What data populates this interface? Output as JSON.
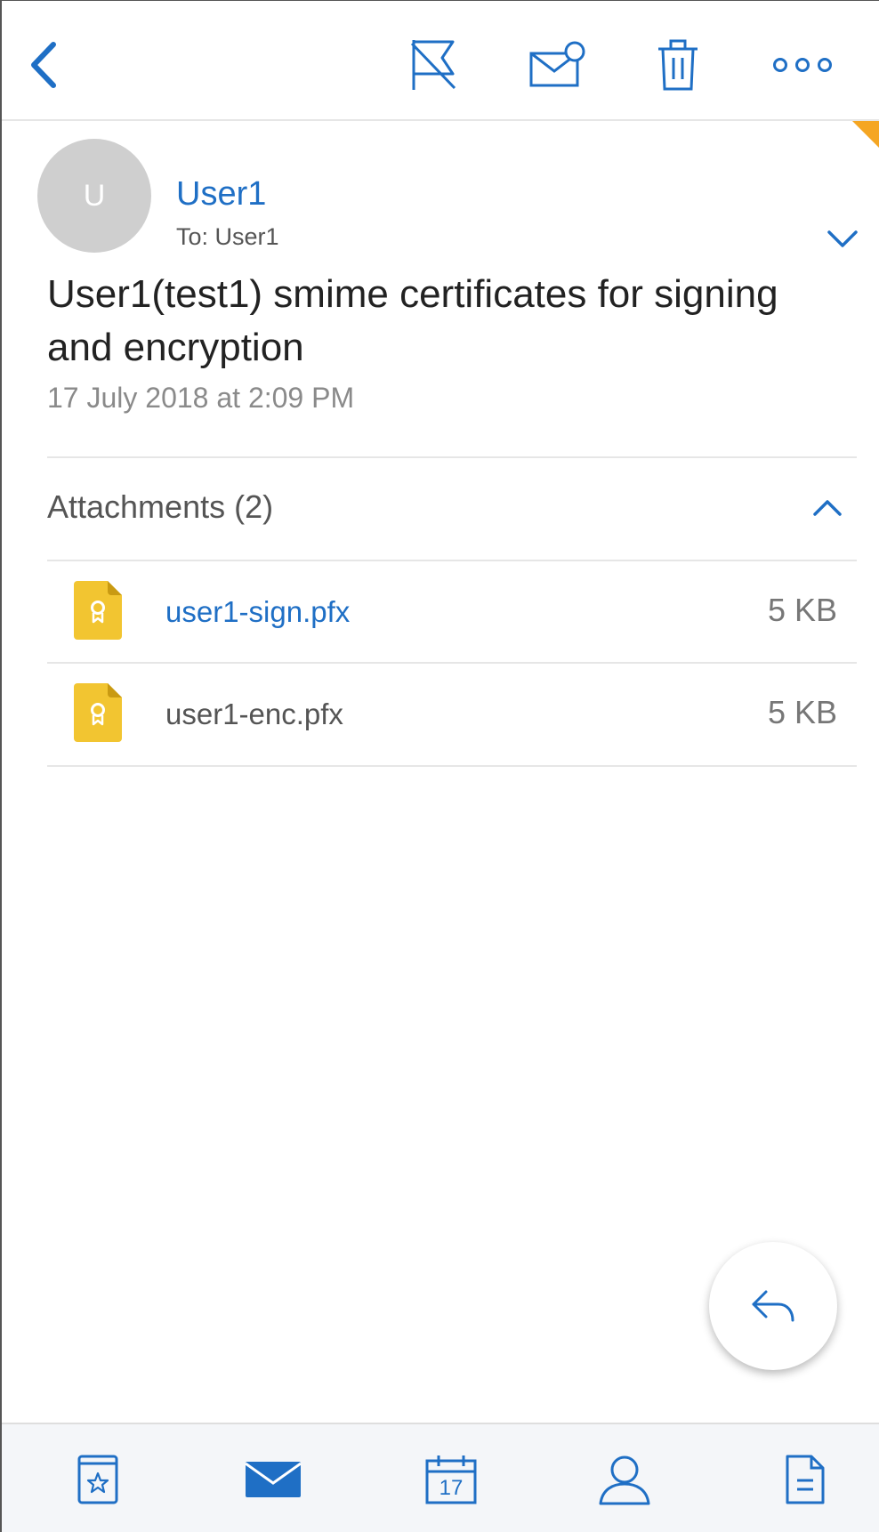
{
  "toolbar": {
    "back_icon": "chevron-left-icon",
    "flag_icon": "flag-icon",
    "mark_read_icon": "mail-unread-icon",
    "delete_icon": "trash-icon",
    "more_icon": "more-horizontal-icon"
  },
  "message": {
    "avatar_letter": "U",
    "sender": "User1",
    "to": "To: User1",
    "subject": "User1(test1) smime certificates for signing and encryption",
    "date": "17 July 2018 at 2:09 PM"
  },
  "attachments": {
    "header": "Attachments (2)",
    "items": [
      {
        "name": "user1-sign.pfx",
        "size": "5 KB",
        "color": "#1f6fc5"
      },
      {
        "name": "user1-enc.pfx",
        "size": "5 KB",
        "color": "#555555"
      }
    ]
  },
  "reply_icon": "reply-icon",
  "tabs": [
    "favorites-icon",
    "mail-icon",
    "calendar-icon",
    "contacts-icon",
    "files-icon"
  ],
  "calendar_day": "17",
  "colors": {
    "accent": "#1f6fc5",
    "certificate": "#f2c531",
    "flag_corner": "#f5a623"
  }
}
